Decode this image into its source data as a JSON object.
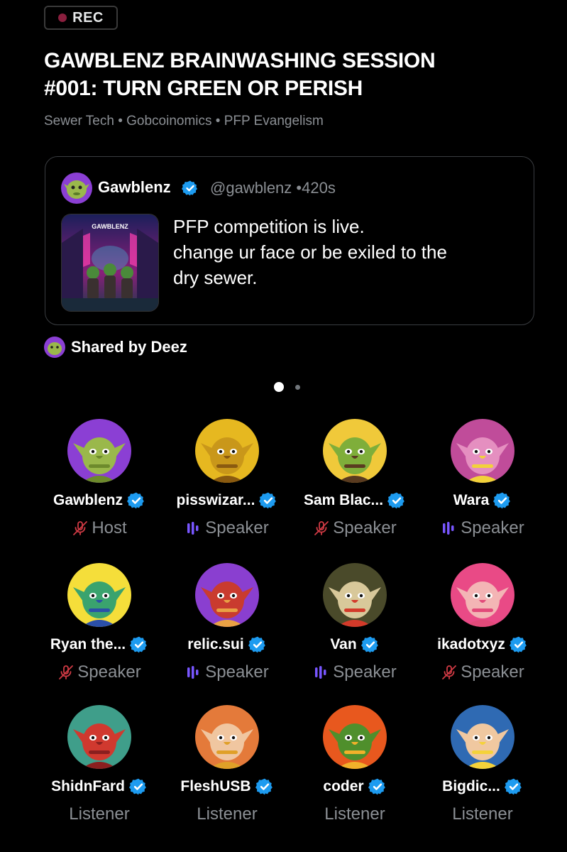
{
  "rec": {
    "label": "REC",
    "dot_color": "#8a1f3e"
  },
  "title": "GAWBLENZ BRAINWASHING SESSION\n#001: TURN GREEN OR PERISH",
  "topics": "Sewer Tech • Gobcoinomics • PFP Evangelism",
  "post": {
    "author": "Gawblenz",
    "handle": "@gawblenz",
    "time": "•420s",
    "text": "PFP competition is live.\nchange ur face or be exiled to the\ndry sewer.",
    "thumb_label": "GAWBLENZ",
    "verified": true
  },
  "shared_by": "Shared by Deez",
  "pager": {
    "pages": 2,
    "active": 0
  },
  "colors": {
    "verified": "#1d9bf0",
    "speaking": "#7856ff",
    "muted": "#d03a44",
    "role_text": "#8b8f94"
  },
  "participants": [
    {
      "name": "Gawblenz",
      "role": "Host",
      "mic": "muted",
      "verified": true,
      "avatar_bg": "#8b3fd4",
      "face": "#9ab84b",
      "accent": "#6d8a2c"
    },
    {
      "name": "pisswizar...",
      "role": "Speaker",
      "mic": "speaking",
      "verified": true,
      "avatar_bg": "#e6b820",
      "face": "#c9971a",
      "accent": "#8a5a10"
    },
    {
      "name": "Sam Blac...",
      "role": "Speaker",
      "mic": "muted",
      "verified": true,
      "avatar_bg": "#f0c93a",
      "face": "#7fae3a",
      "accent": "#5a3b20"
    },
    {
      "name": "Wara",
      "role": "Speaker",
      "mic": "speaking",
      "verified": true,
      "avatar_bg": "#c04c9a",
      "face": "#e58fc0",
      "accent": "#f2d23a"
    },
    {
      "name": "Ryan the...",
      "role": "Speaker",
      "mic": "muted",
      "verified": true,
      "avatar_bg": "#f5de3a",
      "face": "#3aa36e",
      "accent": "#2b4fa8"
    },
    {
      "name": "relic.sui",
      "role": "Speaker",
      "mic": "speaking",
      "verified": true,
      "avatar_bg": "#8a3fd0",
      "face": "#c93b2f",
      "accent": "#e9a144"
    },
    {
      "name": "Van",
      "role": "Speaker",
      "mic": "speaking",
      "verified": true,
      "avatar_bg": "#4a4a2a",
      "face": "#d8c89a",
      "accent": "#d33a2a"
    },
    {
      "name": "ikadotxyz",
      "role": "Speaker",
      "mic": "muted",
      "verified": true,
      "avatar_bg": "#e94a86",
      "face": "#f3b5b5",
      "accent": "#e24a7a"
    },
    {
      "name": "ShidnFard",
      "role": "Listener",
      "mic": "none",
      "verified": true,
      "avatar_bg": "#3f9e8a",
      "face": "#d0392f",
      "accent": "#8a1f1f"
    },
    {
      "name": "FleshUSB",
      "role": "Listener",
      "mic": "none",
      "verified": true,
      "avatar_bg": "#e47a3a",
      "face": "#f0c6a0",
      "accent": "#e0a028"
    },
    {
      "name": "coder",
      "role": "Listener",
      "mic": "none",
      "verified": true,
      "avatar_bg": "#e8581e",
      "face": "#4f8f2c",
      "accent": "#f2b12a"
    },
    {
      "name": "Bigdic...",
      "role": "Listener",
      "mic": "none",
      "verified": true,
      "avatar_bg": "#2f6ab3",
      "face": "#f0c8a0",
      "accent": "#f5d23a"
    }
  ]
}
